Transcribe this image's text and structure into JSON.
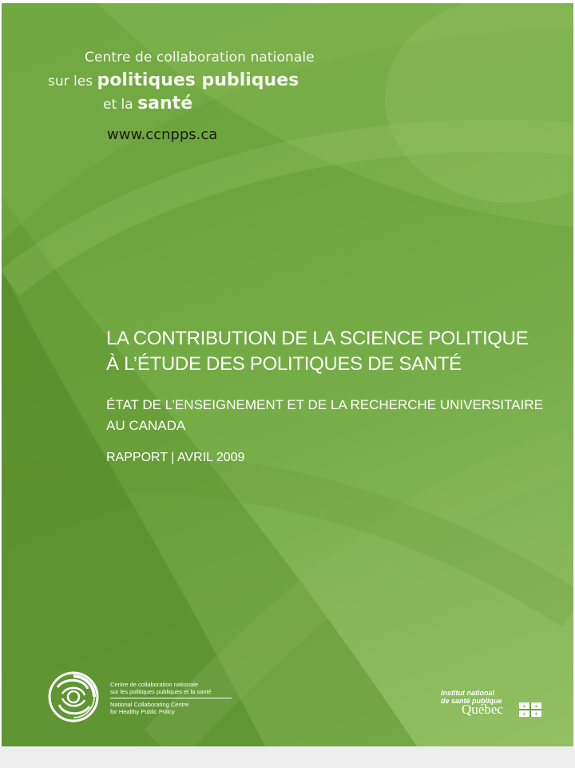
{
  "header": {
    "org_line1": "Centre de collaboration nationale",
    "org_line2_prefix": "sur les ",
    "org_line2_bold": "politiques publiques",
    "org_line3_prefix": "et la ",
    "org_line3_bold": "santé",
    "website": "www.ccnpps.ca"
  },
  "title": {
    "line1": "LA CONTRIBUTION DE LA SCIENCE POLITIQUE",
    "line2": "À L’ÉTUDE DES POLITIQUES DE SANTÉ"
  },
  "subtitle": {
    "line1": "ÉTAT DE L’ENSEIGNEMENT ET DE LA RECHERCHE UNIVERSITAIRE",
    "line2": "AU CANADA"
  },
  "report": "RAPPORT  |  AVRIL 2009",
  "footer": {
    "fr_line1": "Centre de collaboration nationale",
    "fr_line2": "sur les politiques publiques et la santé",
    "en_line1": "National Collaborating Centre",
    "en_line2": "for Healthy Public Policy",
    "inspq_line1": "Institut national",
    "inspq_line2": "de santé publique",
    "quebec": "Québec"
  },
  "colors": {
    "cover_green": "#6ea63e",
    "light_green": "#93c063",
    "text_white": "#ffffff",
    "website_text": "#1a1a1a"
  },
  "icons": {
    "ccnpps_logo": "swirl-circle-logo",
    "quebec_flag": "fleur-de-lis-flag"
  }
}
